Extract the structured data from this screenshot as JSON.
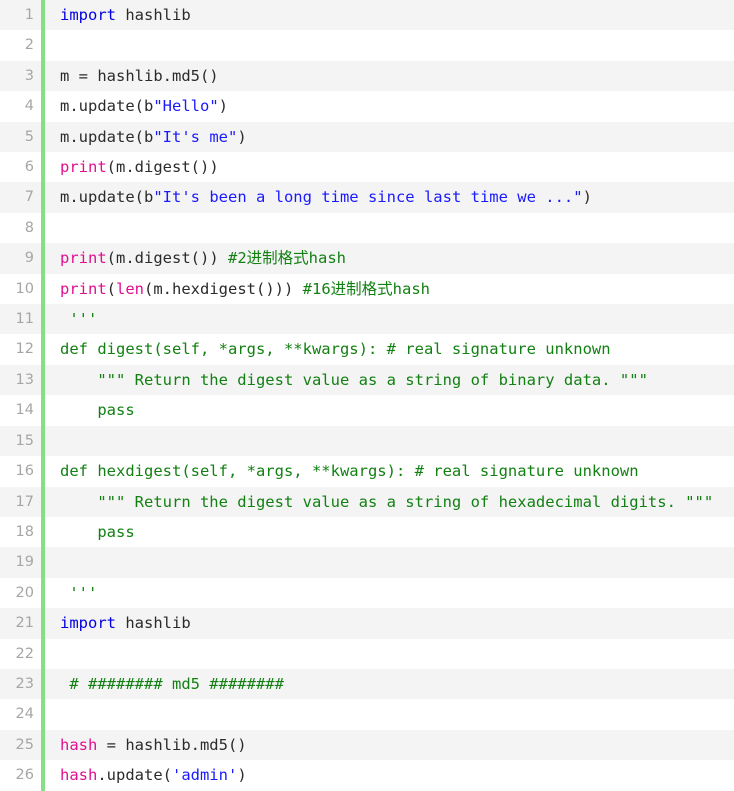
{
  "editor": {
    "language": "python",
    "theme": {
      "background": "#ffffff",
      "alt_row_background": "#f4f4f4",
      "gutter_text": "#a6a6a6",
      "fold_bar": "#85e085",
      "keyword": "#0000e0",
      "builtin": "#e01090",
      "string": "#1a1aff",
      "comment": "#128012",
      "plain_text": "#2b2b2b"
    },
    "total_lines": 26,
    "lines": [
      {
        "number": "1",
        "tokens": [
          {
            "t": "import",
            "c": "kw"
          },
          {
            "t": " hashlib",
            "c": "plain"
          }
        ]
      },
      {
        "number": "2",
        "tokens": []
      },
      {
        "number": "3",
        "tokens": [
          {
            "t": "m = hashlib.md5()",
            "c": "plain"
          }
        ]
      },
      {
        "number": "4",
        "tokens": [
          {
            "t": "m.update(b",
            "c": "plain"
          },
          {
            "t": "\"Hello\"",
            "c": "str"
          },
          {
            "t": ")",
            "c": "plain"
          }
        ]
      },
      {
        "number": "5",
        "tokens": [
          {
            "t": "m.update(b",
            "c": "plain"
          },
          {
            "t": "\"It's me\"",
            "c": "str"
          },
          {
            "t": ")",
            "c": "plain"
          }
        ]
      },
      {
        "number": "6",
        "tokens": [
          {
            "t": "print",
            "c": "builtin"
          },
          {
            "t": "(m.digest())",
            "c": "plain"
          }
        ]
      },
      {
        "number": "7",
        "tokens": [
          {
            "t": "m.update(b",
            "c": "plain"
          },
          {
            "t": "\"It's been a long time since last time we ...\"",
            "c": "str"
          },
          {
            "t": ")",
            "c": "plain"
          }
        ]
      },
      {
        "number": "8",
        "tokens": []
      },
      {
        "number": "9",
        "tokens": [
          {
            "t": "print",
            "c": "builtin"
          },
          {
            "t": "(m.digest()) ",
            "c": "plain"
          },
          {
            "t": "#2进制格式hash",
            "c": "comment"
          }
        ]
      },
      {
        "number": "10",
        "tokens": [
          {
            "t": "print",
            "c": "builtin"
          },
          {
            "t": "(",
            "c": "plain"
          },
          {
            "t": "len",
            "c": "builtin"
          },
          {
            "t": "(m.hexdigest())) ",
            "c": "plain"
          },
          {
            "t": "#16进制格式hash",
            "c": "comment"
          }
        ]
      },
      {
        "number": "11",
        "tokens": [
          {
            "t": " '''",
            "c": "green"
          }
        ]
      },
      {
        "number": "12",
        "tokens": [
          {
            "t": "def digest(self, *args, **kwargs): # real signature unknown",
            "c": "green"
          }
        ]
      },
      {
        "number": "13",
        "tokens": [
          {
            "t": "    \"\"\" Return the digest value as a string of binary data. \"\"\"",
            "c": "green"
          }
        ]
      },
      {
        "number": "14",
        "tokens": [
          {
            "t": "    pass",
            "c": "green"
          }
        ]
      },
      {
        "number": "15",
        "tokens": []
      },
      {
        "number": "16",
        "tokens": [
          {
            "t": "def hexdigest(self, *args, **kwargs): # real signature unknown",
            "c": "green"
          }
        ]
      },
      {
        "number": "17",
        "tokens": [
          {
            "t": "    \"\"\" Return the digest value as a string of hexadecimal digits. \"\"\"",
            "c": "green"
          }
        ]
      },
      {
        "number": "18",
        "tokens": [
          {
            "t": "    pass",
            "c": "green"
          }
        ]
      },
      {
        "number": "19",
        "tokens": []
      },
      {
        "number": "20",
        "tokens": [
          {
            "t": " '''",
            "c": "green"
          }
        ]
      },
      {
        "number": "21",
        "tokens": [
          {
            "t": "import",
            "c": "kw"
          },
          {
            "t": " hashlib",
            "c": "plain"
          }
        ]
      },
      {
        "number": "22",
        "tokens": []
      },
      {
        "number": "23",
        "tokens": [
          {
            "t": " # ######## md5 ########",
            "c": "comment"
          }
        ]
      },
      {
        "number": "24",
        "tokens": []
      },
      {
        "number": "25",
        "tokens": [
          {
            "t": "hash",
            "c": "builtin"
          },
          {
            "t": " = hashlib.md5()",
            "c": "plain"
          }
        ]
      },
      {
        "number": "26",
        "tokens": [
          {
            "t": "hash",
            "c": "builtin"
          },
          {
            "t": ".update(",
            "c": "plain"
          },
          {
            "t": "'admin'",
            "c": "str"
          },
          {
            "t": ")",
            "c": "plain"
          }
        ]
      }
    ]
  }
}
